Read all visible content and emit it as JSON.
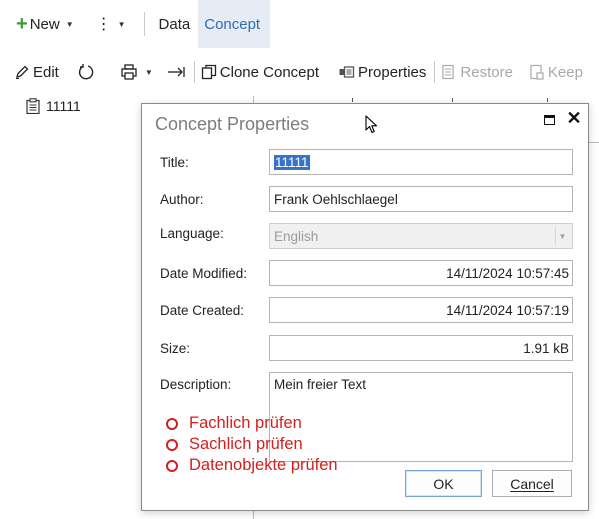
{
  "menubar": {
    "new_label": "New",
    "tabs": [
      {
        "label": "Data"
      },
      {
        "label": "Concept"
      }
    ]
  },
  "toolbar": {
    "edit_label": "Edit",
    "clone_label": "Clone Concept",
    "properties_label": "Properties",
    "restore_label": "Restore",
    "keep_label": "Keep"
  },
  "tree": {
    "item_label": "11111"
  },
  "dialog": {
    "title": "Concept Properties",
    "fields": {
      "title_label": "Title:",
      "title_value": "11111",
      "author_label": "Author:",
      "author_value": "Frank Oehlschlaegel",
      "language_label": "Language:",
      "language_value": "English",
      "date_modified_label": "Date Modified:",
      "date_modified_value": "14/11/2024 10:57:45",
      "date_created_label": "Date Created:",
      "date_created_value": "14/11/2024 10:57:19",
      "size_label": "Size:",
      "size_value": "1.91 kB",
      "description_label": "Description:",
      "description_value": "Mein freier Text"
    },
    "ok_label": "OK",
    "cancel_label": "Cancel"
  },
  "annotations": [
    {
      "text": "Fachlich prüfen"
    },
    {
      "text": "Sachlich prüfen"
    },
    {
      "text": "Datenobjekte prüfen"
    }
  ],
  "colors": {
    "accent": "#2e6db4",
    "active_tab_bg": "#e5ecf5",
    "selection": "#3574c9",
    "annotation_red": "#d22020",
    "new_plus_green": "#3a9a3a"
  }
}
